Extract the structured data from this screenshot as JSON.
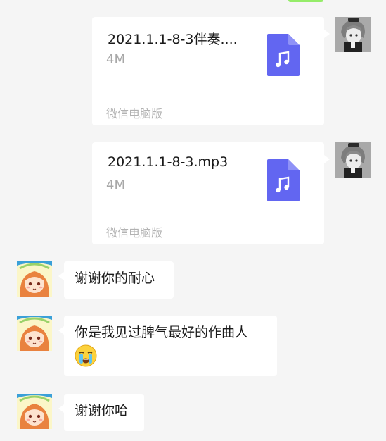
{
  "conversation": {
    "sent_files": [
      {
        "file_name": "2021.1.1-8-3伴奏....",
        "file_size": "4M",
        "source": "微信电脑版",
        "icon": "music-file-icon"
      },
      {
        "file_name": "2021.1.1-8-3.mp3",
        "file_size": "4M",
        "source": "微信电脑版",
        "icon": "music-file-icon"
      }
    ],
    "received_messages": [
      {
        "text": "谢谢你的耐心"
      },
      {
        "text": "你是我见过脾气最好的作曲人",
        "emoji": "crying-face-emoji"
      },
      {
        "text": "谢谢你哈"
      }
    ]
  },
  "colors": {
    "background": "#f5f5f5",
    "bubble": "#ffffff",
    "file_icon": "#6266f1",
    "sent_bubble_green": "#95ec69"
  }
}
